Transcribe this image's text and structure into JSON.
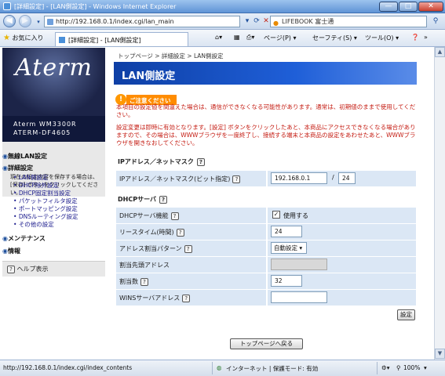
{
  "window": {
    "title": "[詳細設定] - [LAN側設定] - Windows Internet Explorer",
    "min": "—",
    "max": "□",
    "close": "✕"
  },
  "addressbar": {
    "url": "http://192.168.0.1/index.cgi/lan_main",
    "search_text": "LIFEBOOK 富士通"
  },
  "favbar": {
    "favorites": "お気に入り",
    "tab": "[詳細設定] - [LAN側設定]",
    "page": "ページ(P) ▾",
    "safety": "セーフティ(S) ▾",
    "tools": "ツール(O) ▾",
    "help_icon": "❓",
    "more": "»"
  },
  "sidebar": {
    "brand": "Aterm",
    "model_line1": "Aterm WM3300R",
    "model_line2": "ATERM-DF4605",
    "notice": "現在の設定内容を保存する場合は、[保存] ボタンをクリックしてください。",
    "menu": {
      "wireless": "無線LAN設定",
      "advanced": "詳細設定",
      "items": [
        "LAN側設定",
        "DHCP除外設定",
        "DHCP固定割当設定",
        "パケットフィルタ設定",
        "ポートマッピング設定",
        "DNSルーティング設定",
        "その他の設定"
      ],
      "maintenance": "メンテナンス",
      "info": "情報"
    },
    "help": "ヘルプ表示"
  },
  "main": {
    "breadcrumb": "トップページ > 詳細設定 > LAN側設定",
    "title": "LAN側設定",
    "warn_badge": "ご注意ください",
    "warn1": "本項目の設定値を間違えた場合は、通信ができなくなる可能性があります。通常は、初期値のままで使用してください。",
    "warn2": "設定変更は即時に有効となります。[設定] ボタンをクリックしたあと、本商品にアクセスできなくなる場合がありますので、その場合は、WWWブラウザを一度終了し、接続する端末と本商品の設定をあわせたあと、WWWブラウザを開きなおしてください。",
    "ip_section": "IPアドレス／ネットマスク",
    "ip_label": "IPアドレス／ネットマスク(ビット指定)",
    "ip_value": "192.168.0.1",
    "slash": "/",
    "mask_value": "24",
    "dhcp_section": "DHCPサーバ",
    "rows": {
      "func_label": "DHCPサーバ機能",
      "func_value": "使用する",
      "lease_label": "リースタイム(時間)",
      "lease_value": "24",
      "pattern_label": "アドレス割当パターン",
      "pattern_value": "自動設定",
      "start_label": "割当先頭アドレス",
      "start_value": "",
      "count_label": "割当数",
      "count_value": "32",
      "wins_label": "WINSサーバアドレス",
      "wins_value": ""
    },
    "set_button": "設定",
    "top_button": "トップページへ戻る"
  },
  "statusbar": {
    "url": "http://192.168.0.1/index.cgi/index_contents",
    "zone": "インターネット | 保護モード: 有効",
    "zoom": "100%"
  }
}
